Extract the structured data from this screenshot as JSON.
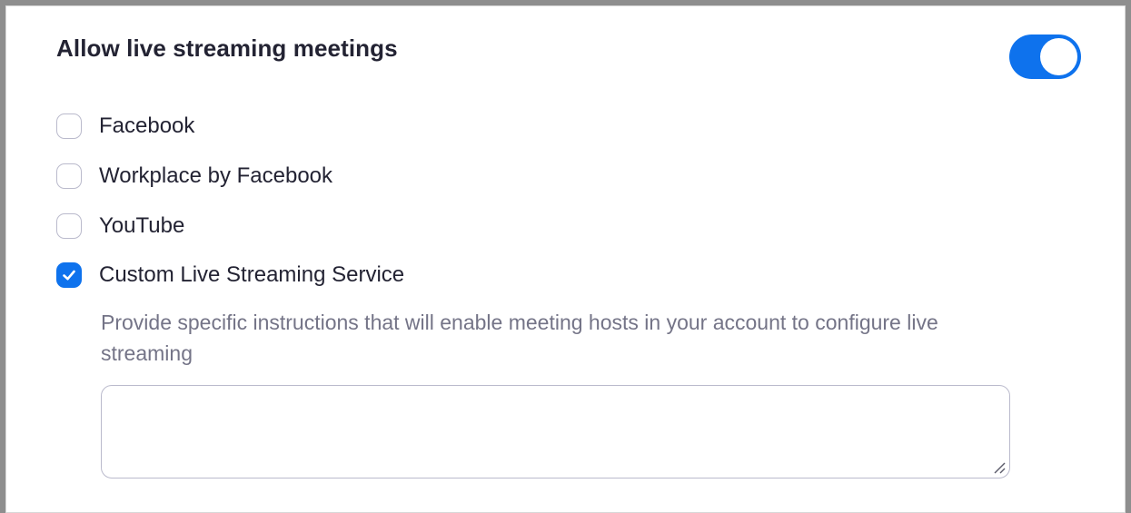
{
  "setting": {
    "title": "Allow live streaming meetings",
    "enabled": true,
    "accent_color": "#0e72ed"
  },
  "options": [
    {
      "label": "Facebook",
      "checked": false
    },
    {
      "label": "Workplace by Facebook",
      "checked": false
    },
    {
      "label": "YouTube",
      "checked": false
    },
    {
      "label": "Custom Live Streaming Service",
      "checked": true
    }
  ],
  "custom_service": {
    "description": "Provide specific instructions that will enable meeting hosts in your account to configure live streaming",
    "instructions_value": "",
    "instructions_placeholder": ""
  },
  "icons": {
    "checkmark": "check-icon",
    "resize": "resize-grip-icon"
  }
}
